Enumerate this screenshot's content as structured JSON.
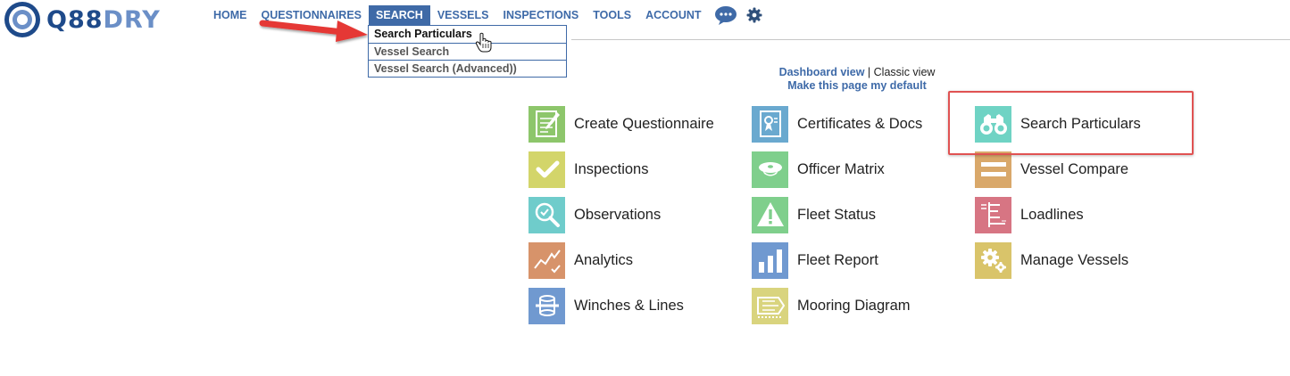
{
  "logo": {
    "text_main": "Q88",
    "text_accent": "DRY"
  },
  "nav": {
    "items": [
      "HOME",
      "QUESTIONNAIRES",
      "SEARCH",
      "VESSELS",
      "INSPECTIONS",
      "TOOLS",
      "ACCOUNT"
    ],
    "active": "SEARCH",
    "icons": [
      "chat-bubble-icon",
      "gear-icon"
    ]
  },
  "search_dropdown": {
    "items": [
      "Search Particulars",
      "Vessel Search",
      "Vessel Search (Advanced))"
    ]
  },
  "view_switch": {
    "dashboard_view": "Dashboard view",
    "separator": "|",
    "classic_view": "Classic view",
    "make_default": "Make this page my default"
  },
  "tiles": {
    "col1": [
      {
        "label": "Create Questionnaire",
        "icon": "questionnaire-icon",
        "color": "#8dc66b"
      },
      {
        "label": "Inspections",
        "icon": "checkmark-icon",
        "color": "#d3d56a"
      },
      {
        "label": "Observations",
        "icon": "magnifier-check-icon",
        "color": "#6fcccb"
      },
      {
        "label": "Analytics",
        "icon": "trend-chart-icon",
        "color": "#d7936a"
      },
      {
        "label": "Winches & Lines",
        "icon": "winch-icon",
        "color": "#7099d0"
      }
    ],
    "col2": [
      {
        "label": "Certificates & Docs",
        "icon": "certificate-icon",
        "color": "#6aa9cf"
      },
      {
        "label": "Officer Matrix",
        "icon": "officer-cap-icon",
        "color": "#7fcf8c"
      },
      {
        "label": "Fleet Status",
        "icon": "warning-triangle-icon",
        "color": "#7fcf8c"
      },
      {
        "label": "Fleet Report",
        "icon": "bar-chart-icon",
        "color": "#7099d0"
      },
      {
        "label": "Mooring Diagram",
        "icon": "mooring-diagram-icon",
        "color": "#d9d47e"
      }
    ],
    "col3": [
      {
        "label": "Search Particulars",
        "icon": "binoculars-icon",
        "color": "#6fd3c4"
      },
      {
        "label": "Vessel Compare",
        "icon": "compare-bars-icon",
        "color": "#d9a86a"
      },
      {
        "label": "Loadlines",
        "icon": "loadline-mark-icon",
        "color": "#d77583"
      },
      {
        "label": "Manage Vessels",
        "icon": "gears-icon",
        "color": "#d9c46a"
      }
    ]
  }
}
